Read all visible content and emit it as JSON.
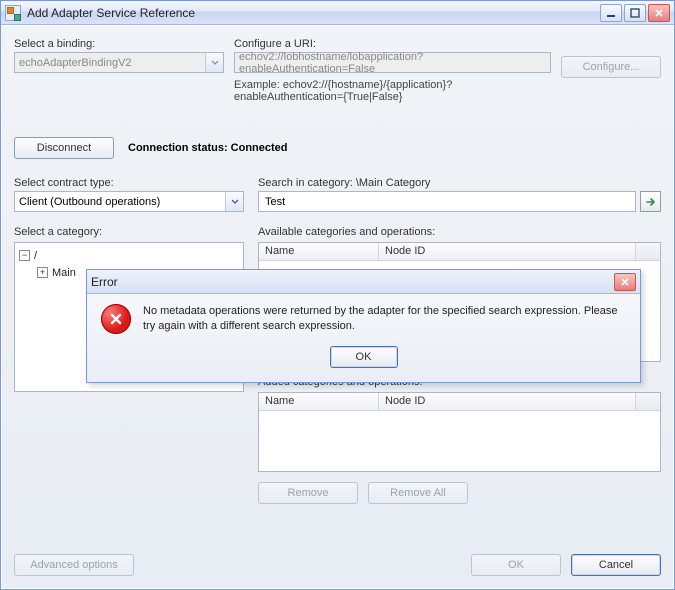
{
  "window": {
    "title": "Add Adapter Service Reference"
  },
  "binding": {
    "label": "Select a binding:",
    "value": "echoAdapterBindingV2"
  },
  "uri": {
    "label": "Configure a URI:",
    "value": "echov2://lobhostname/lobapplication?enableAuthentication=False",
    "example": "Example: echov2://{hostname}/{application}?enableAuthentication={True|False}",
    "configure_label": "Configure..."
  },
  "connection": {
    "disconnect_label": "Disconnect",
    "status_prefix": "Connection status: ",
    "status_value": "Connected"
  },
  "contract": {
    "label": "Select contract type:",
    "value": "Client (Outbound operations)"
  },
  "search": {
    "label": "Search in category: \\Main Category",
    "value": "Test"
  },
  "category": {
    "label": "Select a category:",
    "root": "/",
    "item1": "Main"
  },
  "available": {
    "label": "Available categories and operations:",
    "col_name": "Name",
    "col_node": "Node ID"
  },
  "added": {
    "label": "Added categories and operations:",
    "col_name": "Name",
    "col_node": "Node ID",
    "remove_label": "Remove",
    "remove_all_label": "Remove All"
  },
  "footer": {
    "advanced_label": "Advanced options",
    "ok_label": "OK",
    "cancel_label": "Cancel"
  },
  "error_dialog": {
    "title": "Error",
    "message": "No metadata operations were returned by the adapter for the specified search expression. Please try again with a different search expression.",
    "ok_label": "OK"
  }
}
